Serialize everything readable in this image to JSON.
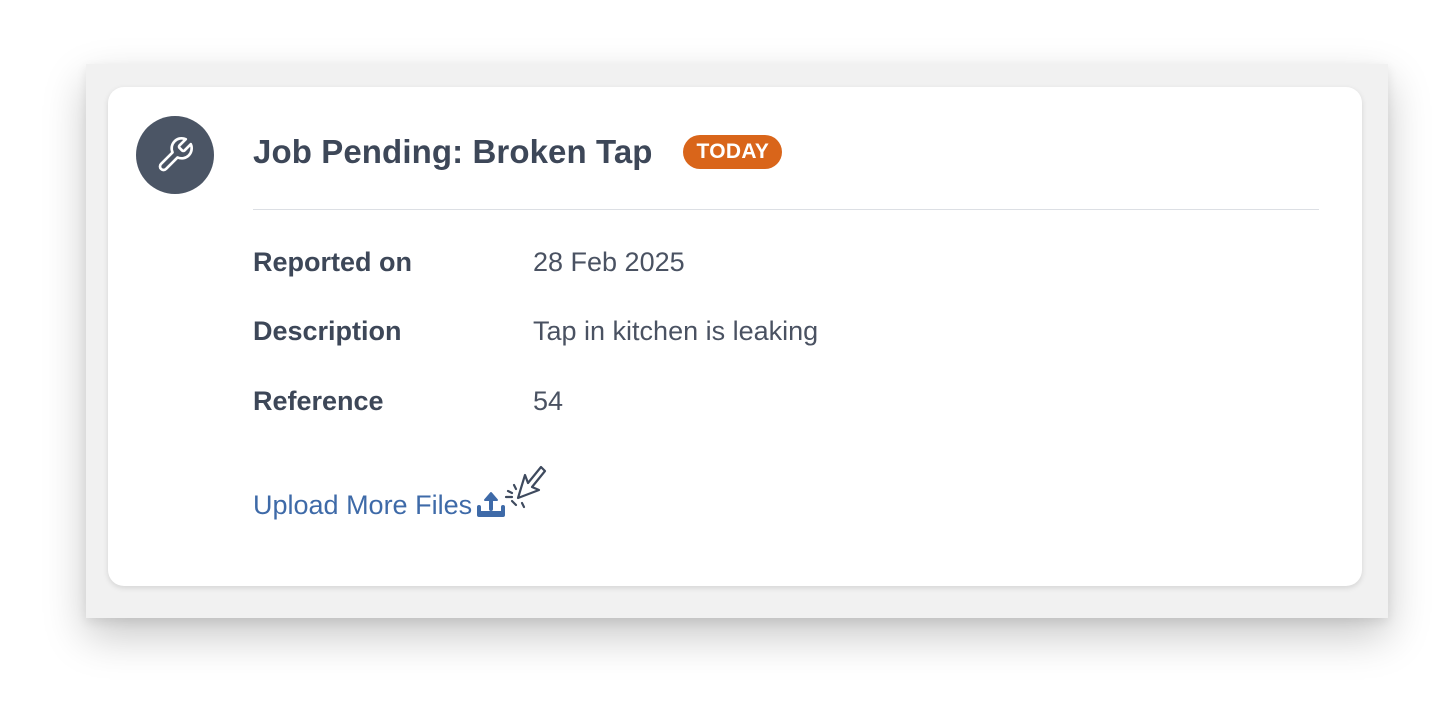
{
  "job": {
    "title": "Job Pending: Broken Tap",
    "badge": "TODAY",
    "icon": "wrench-icon"
  },
  "details": [
    {
      "label": "Reported on",
      "value": "28 Feb 2025"
    },
    {
      "label": "Description",
      "value": "Tap in kitchen is leaking"
    },
    {
      "label": "Reference",
      "value": "54"
    }
  ],
  "actions": {
    "upload_label": "Upload More Files",
    "upload_icon": "upload-icon",
    "cursor_icon": "click-cursor-icon"
  },
  "colors": {
    "badge": "#d9651a",
    "avatar": "#4b5565",
    "link": "#3e6aa8",
    "title": "#3d4758"
  }
}
